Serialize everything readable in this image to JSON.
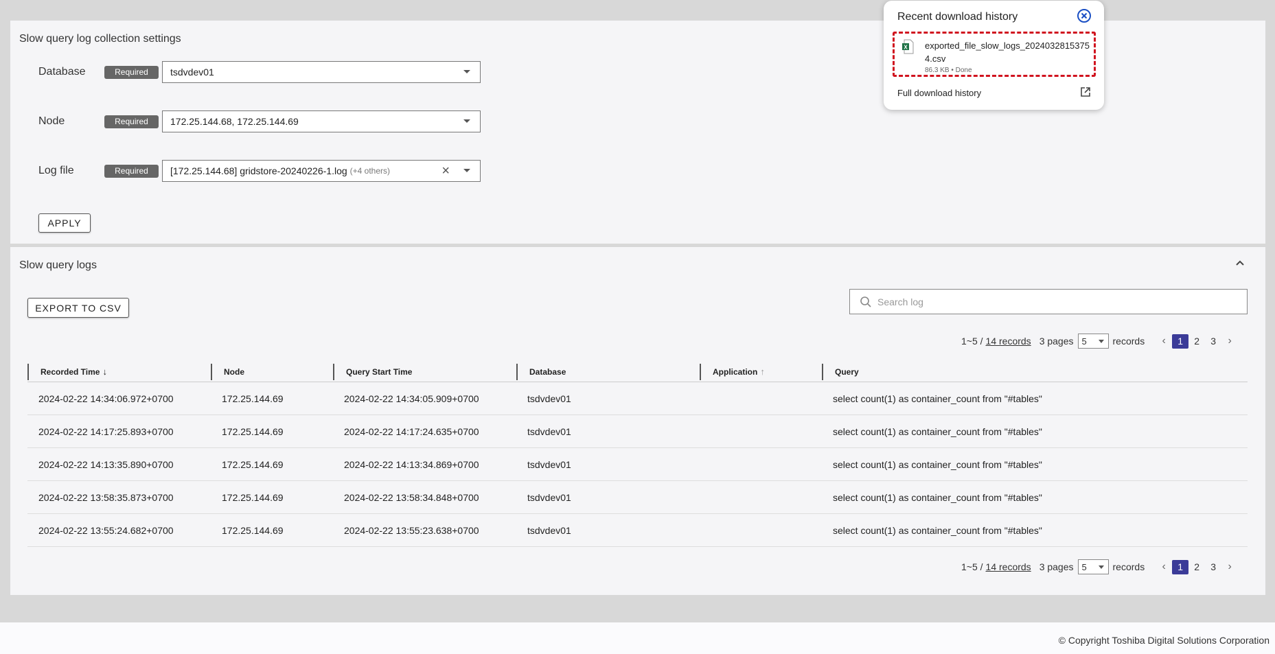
{
  "settings": {
    "title": "Slow query log collection settings",
    "required_label": "Required",
    "database": {
      "label": "Database",
      "value": "tsdvdev01"
    },
    "node": {
      "label": "Node",
      "value": "172.25.144.68, 172.25.144.69"
    },
    "logfile": {
      "label": "Log file",
      "value": "[172.25.144.68] gridstore-20240226-1.log",
      "others": "(+4 others)"
    },
    "apply_label": "APPLY"
  },
  "logs": {
    "title": "Slow query logs",
    "export_label": "EXPORT TO CSV",
    "search_placeholder": "Search log",
    "pagination": {
      "range": "1~5 /",
      "records_link": "14 records",
      "pages": "3 pages",
      "page_size": "5",
      "records_label": "records",
      "pages_list": [
        "1",
        "2",
        "3"
      ],
      "current_page": "1"
    },
    "columns": [
      "Recorded Time",
      "Node",
      "Query Start Time",
      "Database",
      "Application",
      "Query"
    ],
    "rows": [
      [
        "2024-02-22 14:34:06.972+0700",
        "172.25.144.69",
        "2024-02-22 14:34:05.909+0700",
        "tsdvdev01",
        "",
        "select count(1) as container_count from \"#tables\""
      ],
      [
        "2024-02-22 14:17:25.893+0700",
        "172.25.144.69",
        "2024-02-22 14:17:24.635+0700",
        "tsdvdev01",
        "",
        "select count(1) as container_count from \"#tables\""
      ],
      [
        "2024-02-22 14:13:35.890+0700",
        "172.25.144.69",
        "2024-02-22 14:13:34.869+0700",
        "tsdvdev01",
        "",
        "select count(1) as container_count from \"#tables\""
      ],
      [
        "2024-02-22 13:58:35.873+0700",
        "172.25.144.69",
        "2024-02-22 13:58:34.848+0700",
        "tsdvdev01",
        "",
        "select count(1) as container_count from \"#tables\""
      ],
      [
        "2024-02-22 13:55:24.682+0700",
        "172.25.144.69",
        "2024-02-22 13:55:23.638+0700",
        "tsdvdev01",
        "",
        "select count(1) as container_count from \"#tables\""
      ]
    ]
  },
  "download": {
    "title": "Recent download history",
    "file_name": "exported_file_slow_logs_20240328153754.csv",
    "meta": "86.3 KB • Done",
    "full_history": "Full download history"
  },
  "footer": {
    "copyright": "© Copyright Toshiba Digital Solutions Corporation"
  },
  "colors": {
    "accent": "#3b3b98",
    "highlight": "#d0131f",
    "excel_green": "#1e7145"
  }
}
